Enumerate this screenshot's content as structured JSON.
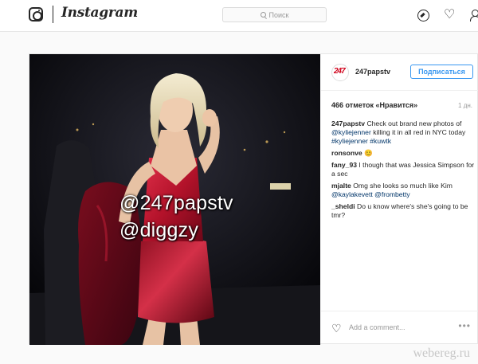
{
  "nav": {
    "logo": "Instagram",
    "search_placeholder": "Поиск",
    "icons": [
      "camera-icon",
      "compass-icon",
      "heart-icon",
      "user-icon"
    ]
  },
  "post": {
    "username": "247papstv",
    "follow_label": "Подписаться",
    "likes": "466 отметок «Нравится»",
    "time": "1 дн.",
    "photo_overlay": [
      "@247papstv",
      "@diggzy"
    ],
    "comments": [
      {
        "user": "247papstv",
        "parts": [
          {
            "t": "Check out brand new photos of "
          },
          {
            "t": "@kyliejenner",
            "tag": true
          },
          {
            "t": " killing it in all red in NYC today "
          },
          {
            "t": "#kyliejenner",
            "tag": true
          },
          {
            "t": " "
          },
          {
            "t": "#kuwtk",
            "tag": true
          }
        ]
      },
      {
        "user": "ronsonve",
        "parts": [
          {
            "t": "😊"
          }
        ]
      },
      {
        "user": "fany_93",
        "parts": [
          {
            "t": "I though that was Jessica Simpson for a sec"
          }
        ]
      },
      {
        "user": "mjalte",
        "parts": [
          {
            "t": "Omg she looks so much like Kim "
          },
          {
            "t": "@kaylakevett",
            "tag": true
          },
          {
            "t": " "
          },
          {
            "t": "@frombetty",
            "tag": true
          }
        ]
      },
      {
        "user": "_sheldi",
        "parts": [
          {
            "t": "Do u know where's she's going to be tmr?"
          }
        ]
      }
    ],
    "add_comment_placeholder": "Add a comment...",
    "more_label": "•••"
  },
  "watermark": "webereg.ru",
  "colors": {
    "accent": "#3897f0",
    "tag": "#003569",
    "dress": "#b3122a"
  }
}
